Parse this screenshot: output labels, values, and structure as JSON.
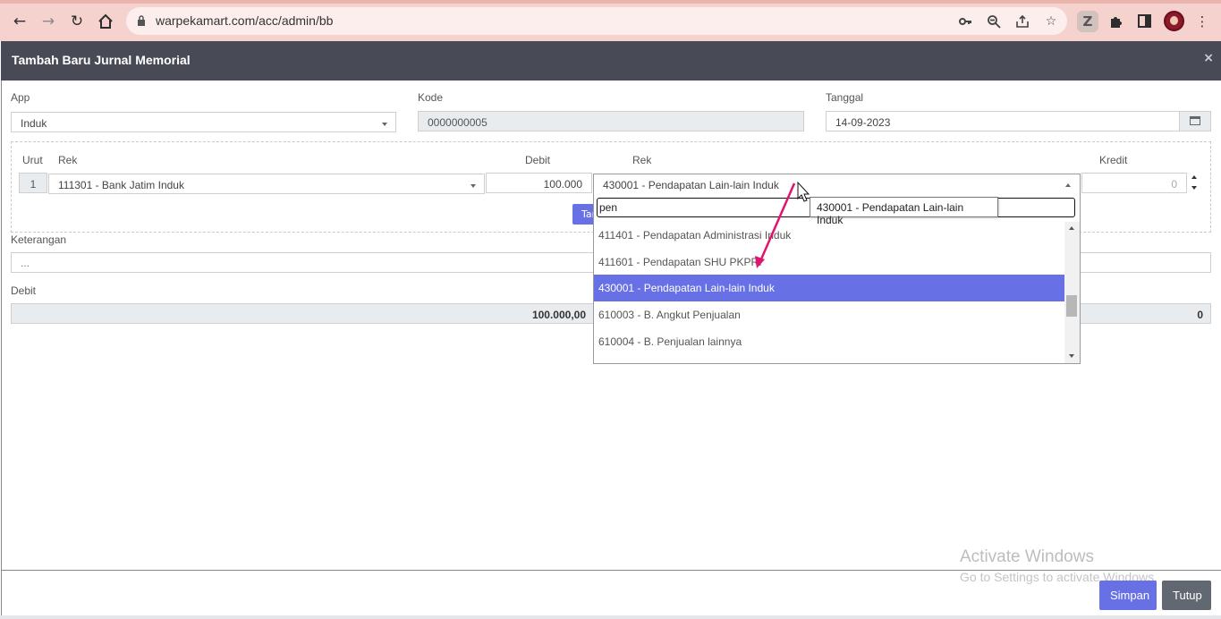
{
  "browser": {
    "url": "warpekamart.com/acc/admin/bb"
  },
  "modal": {
    "title": "Tambah Baru Jurnal Memorial",
    "close_icon": "×"
  },
  "form": {
    "app_label": "App",
    "app_value": "Induk",
    "kode_label": "Kode",
    "kode_value": "0000000005",
    "tanggal_label": "Tanggal",
    "tanggal_value": "14-09-2023"
  },
  "detail": {
    "urut_label": "Urut",
    "rek_label": "Rek",
    "debit_label": "Debit",
    "rek2_label": "Rek",
    "kredit_label": "Kredit",
    "urut_value": "1",
    "rek_value": "111301 - Bank Jatim Induk",
    "debit_value": "100.000",
    "rek2_value": "430001 - Pendapatan Lain-lain Induk",
    "kredit_value": "0",
    "tambah_label": "Tambah"
  },
  "keterangan": {
    "label": "Keterangan",
    "placeholder": "..."
  },
  "totals": {
    "debit_label": "Debit",
    "debit_value": "100.000,00",
    "kredit_value": "0"
  },
  "dropdown": {
    "search_value": "pen",
    "tooltip": "430001 - Pendapatan Lain-lain Induk",
    "options": [
      "411401 - Pendapatan Administrasi Induk",
      "411601 - Pendapatan SHU PKPRI",
      "430001 - Pendapatan Lain-lain Induk",
      "610003 - B. Angkut Penjualan",
      "610004 - B. Penjualan lainnya"
    ],
    "selected_index": 2
  },
  "footer": {
    "simpan_label": "Simpan",
    "tutup_label": "Tutup"
  },
  "watermark": {
    "line1": "Activate Windows",
    "line2": "Go to Settings to activate Windows."
  },
  "colors": {
    "accent": "#6771e5",
    "header": "#484a55",
    "chrome": "#f5d2cd",
    "annotation_arrow": "#e0146e"
  }
}
